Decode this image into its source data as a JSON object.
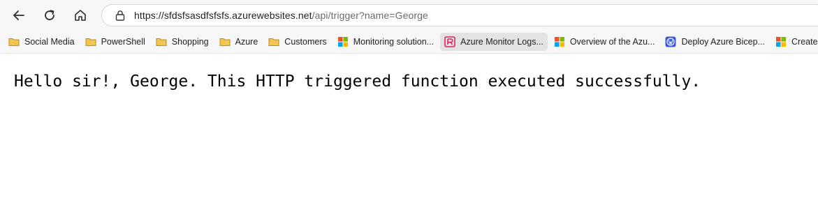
{
  "toolbar": {
    "back_icon": "back-arrow-icon",
    "refresh_icon": "refresh-icon",
    "home_icon": "home-icon"
  },
  "address_bar": {
    "lock_icon": "lock-icon",
    "url_host": "https://sfdsfsasdfsfsfs.azurewebsites.net",
    "url_path": "/api/trigger?name=George"
  },
  "bookmarks": [
    {
      "label": "Social Media",
      "icon": "folder-icon"
    },
    {
      "label": "PowerShell",
      "icon": "folder-icon"
    },
    {
      "label": "Shopping",
      "icon": "folder-icon"
    },
    {
      "label": "Azure",
      "icon": "folder-icon"
    },
    {
      "label": "Customers",
      "icon": "folder-icon"
    },
    {
      "label": "Monitoring solution...",
      "icon": "microsoft-logo-icon"
    },
    {
      "label": "Azure Monitor Logs...",
      "icon": "azure-monitor-logs-icon"
    },
    {
      "label": "Overview of the Azu...",
      "icon": "microsoft-logo-icon"
    },
    {
      "label": "Deploy Azure Bicep...",
      "icon": "wordpress-icon"
    },
    {
      "label": "Create diagr",
      "icon": "microsoft-logo-icon"
    }
  ],
  "colors": {
    "folder": "#f3c44f",
    "ms_red": "#f25022",
    "ms_green": "#7fba00",
    "ms_blue": "#00a4ef",
    "ms_yellow": "#ffb900",
    "wordpress_blue": "#3858e9",
    "monitor_pink": "#e0245e"
  },
  "page": {
    "message": "Hello sir!, George. This HTTP triggered function executed successfully."
  }
}
